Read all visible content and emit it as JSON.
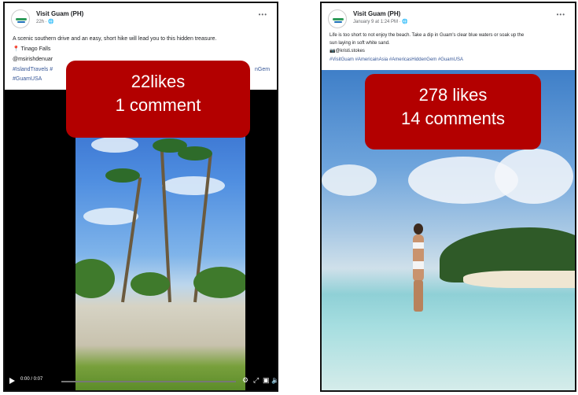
{
  "left_post": {
    "page_name": "Visit Guam (PH)",
    "time": "22h · ",
    "caption_line1": "A scenic southern drive and an easy, short hike will lead you to this hidden treasure.",
    "location_line": "📍 Tinago Falls",
    "mention_line": "@msirishdenuar",
    "hashtags_line1": "#IslandTravels #",
    "hashtags_line1_end": "nGem",
    "hashtags_line2": "#GuamUSA",
    "video_time": "0:00 / 0:07",
    "progress": 0.0,
    "overlay_line1": "22likes",
    "overlay_line2": "1 comment"
  },
  "right_post": {
    "page_name": "Visit Guam (PH)",
    "time": "January 9 at 1:24 PM · ",
    "caption_line1": "Life is too short to not enjoy the beach. Take a dip in Guam's clear blue waters or soak up the",
    "caption_line2": "sun laying in soft white sand.",
    "credit_line": "📷@kristi.stokes",
    "hashtags": "#VisitGuam #AmericainAsia #AmericasHiddenGem #GuamUSA",
    "overlay_line1": "278 likes",
    "overlay_line2": "14 comments"
  },
  "icons": {
    "more": "more-icon",
    "play": "play-icon",
    "settings": "gear-icon",
    "fullscreen": "fullscreen-icon",
    "pip": "picture-in-picture-icon",
    "volume": "volume-icon"
  },
  "colors": {
    "overlay": "#b30000",
    "link": "#385898"
  }
}
